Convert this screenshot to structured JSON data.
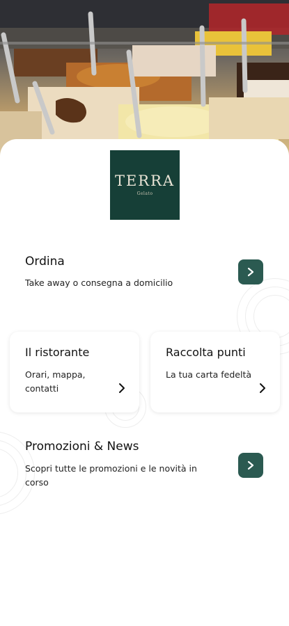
{
  "hero": {
    "alt_icon": "gelato-display-photo"
  },
  "logo": {
    "brand": "TERRA",
    "tagline": "Gelato"
  },
  "ordina": {
    "title": "Ordina",
    "description": "Take away o consegna a domicilio",
    "button_icon": "chevron-right-icon"
  },
  "cards": [
    {
      "title": "Il ristorante",
      "description": "Orari, mappa, contatti",
      "icon": "chevron-right-icon"
    },
    {
      "title": "Raccolta punti",
      "description": "La tua carta fedeltà",
      "icon": "chevron-right-icon"
    }
  ],
  "promo": {
    "title": "Promozioni & News",
    "description": "Scopri tutte le promozioni e le novità in corso",
    "button_icon": "chevron-right-icon"
  },
  "colors": {
    "brand_green": "#163f37",
    "button_green": "#2b5a51"
  }
}
